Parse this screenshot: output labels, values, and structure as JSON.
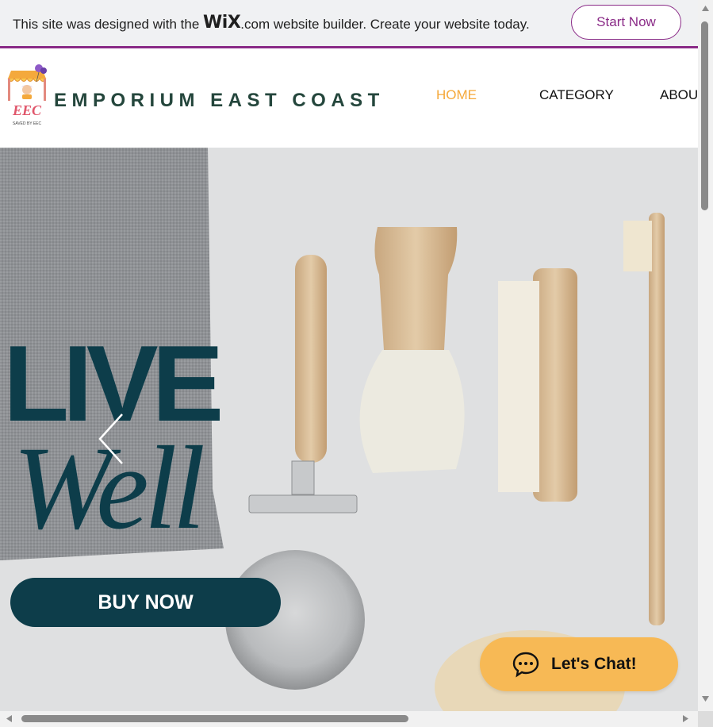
{
  "wix_banner": {
    "text_before": "This site was designed with the ",
    "logo_wix": "WiX",
    "logo_dotcom": ".com",
    "text_after": " website builder. Create your website today.",
    "button_label": "Start Now"
  },
  "header": {
    "logo_text": "EEC",
    "logo_subtext": "SAVED BY EEC",
    "brand": "EMPORIUM EAST COAST",
    "nav": {
      "home": "HOME",
      "category": "CATEGORY",
      "about": "ABOU"
    }
  },
  "hero": {
    "headline_1": "LIVE",
    "headline_2": "Well",
    "buy_button": "BUY NOW"
  },
  "chat": {
    "label": "Let's Chat!"
  },
  "colors": {
    "brand_teal": "#0d3d4a",
    "wix_purple": "#8a2a87",
    "nav_active": "#f5a83a",
    "chat_yellow": "#f7b955"
  },
  "icons": [
    "prev-arrow-icon",
    "chat-bubble-icon",
    "scroll-up-icon",
    "scroll-down-icon",
    "scroll-left-icon",
    "scroll-right-icon"
  ]
}
